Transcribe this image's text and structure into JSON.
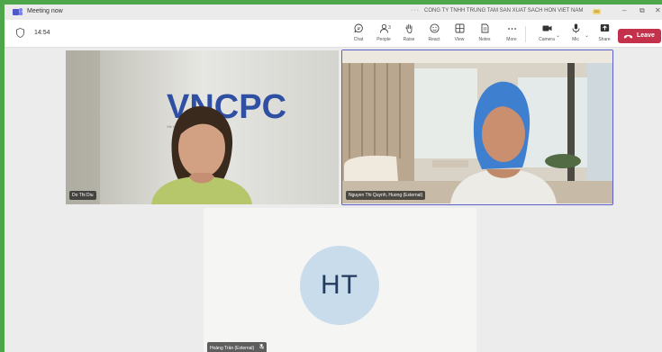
{
  "window": {
    "title": "Meeting now",
    "more_dots": "···",
    "organization": "CONG TY TNHH TRUNG TAM SAN XUAT SACH HON VIET NAM",
    "org_badge": "DD"
  },
  "toolbar": {
    "timer": "14:54",
    "buttons": [
      {
        "label": "Chat",
        "icon": "chat-icon"
      },
      {
        "label": "People",
        "icon": "people-icon",
        "count": "3"
      },
      {
        "label": "Raise",
        "icon": "raise-hand-icon"
      },
      {
        "label": "React",
        "icon": "react-icon"
      },
      {
        "label": "View",
        "icon": "view-icon"
      },
      {
        "label": "Notes",
        "icon": "notes-icon"
      },
      {
        "label": "More",
        "icon": "more-icon"
      },
      {
        "label": "Camera",
        "icon": "camera-icon"
      },
      {
        "label": "Mic",
        "icon": "mic-icon"
      },
      {
        "label": "Share",
        "icon": "share-icon"
      }
    ],
    "leave_label": "Leave"
  },
  "participants": [
    {
      "name": "Do Thi Diu",
      "video": true,
      "active_speaker": false,
      "backdrop_logo": "VNCPC"
    },
    {
      "name": "Nguyen Thi Quynh, Huong (External)",
      "video": true,
      "active_speaker": true
    },
    {
      "name": "Hoàng Trần (External)",
      "video": false,
      "initials": "HT",
      "muted": true
    }
  ],
  "colors": {
    "frame_border": "#4ea64a",
    "leave": "#c4314b",
    "active_speaker_border": "#5b5fc7",
    "avatar_bg": "#c9dcec"
  }
}
